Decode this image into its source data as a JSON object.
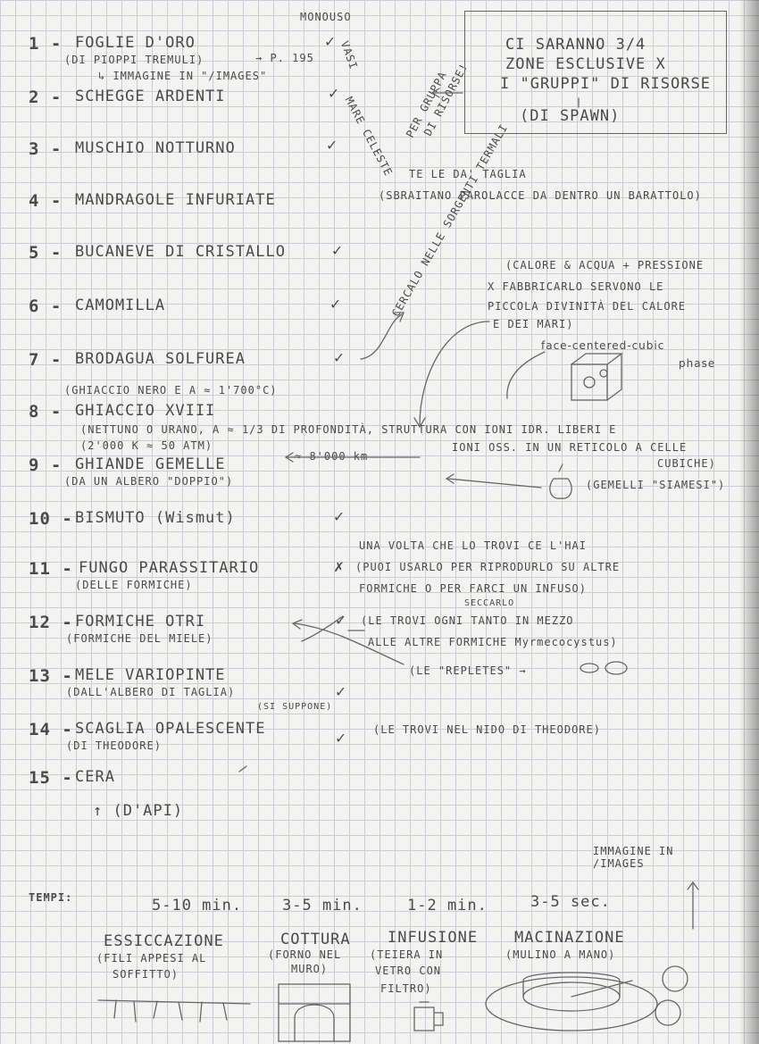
{
  "header": {
    "monouso": "MONOUSO"
  },
  "items": [
    {
      "number": "1 -",
      "name": "FOGLIE D'ORO",
      "sub": "(DI PIOPPI TREMULI)",
      "note": "→ P. 195",
      "note2": "↳ IMMAGINE IN \"/IMAGES\"",
      "check": "✓"
    },
    {
      "number": "2 -",
      "name": "SCHEGGE ARDENTI",
      "check": "✓"
    },
    {
      "number": "3 -",
      "name": "MUSCHIO NOTTURNO",
      "check": "✓"
    },
    {
      "number": "4 -",
      "name": "MANDRAGOLE INFURIATE"
    },
    {
      "number": "5 -",
      "name": "BUCANEVE DI CRISTALLO",
      "check": "✓"
    },
    {
      "number": "6 -",
      "name": "CAMOMILLA",
      "check": "✓"
    },
    {
      "number": "7 -",
      "name": "BRODAGUA SOLFUREA",
      "check": "✓"
    },
    {
      "number": "8 -",
      "name": "GHIACCIO XVIII",
      "pre": "(GHIACCIO NERO E A ≈ 1'700°C)",
      "sub": "(NETTUNO O URANO, A ≈ 1/3 DI PROFONDITÀ, STRUTTURA CON IONI IDR. LIBERI E",
      "sub2": "(2'000 K ≈ 50 ATM)",
      "sub3": "IONI OSS. IN UN RETICOLO A CELLE",
      "sub4": "CUBICHE)",
      "depth": "≈ 8'000 km"
    },
    {
      "number": "9 -",
      "name": "GHIANDE GEMELLE",
      "sub": "(DA UN ALBERO \"DOPPIO\")"
    },
    {
      "number": "10 -",
      "name": "BISMUTO (Wismut)",
      "check": "✓"
    },
    {
      "number": "11 -",
      "name": "FUNGO PARASSITARIO",
      "sub": "(DELLE FORMICHE)",
      "check": "✗"
    },
    {
      "number": "12 -",
      "name": "FORMICHE OTRI",
      "sub": "(FORMICHE DEL MIELE)",
      "check": "✓"
    },
    {
      "number": "13 -",
      "name": "MELE VARIOPINTE",
      "sub": "(DALL'ALBERO DI TAGLIA)",
      "check": "✓"
    },
    {
      "number": "14 -",
      "name": "SCAGLIA OPALESCENTE",
      "sub": "(DI THEODORE)",
      "check": "✓"
    },
    {
      "number": "15 -",
      "name": "CERA",
      "sub": "↑ (D'API)"
    }
  ],
  "box": {
    "line1": "CI SARANNO 3/4",
    "line2": "ZONE ESCLUSIVE X",
    "line3": "I \"GRUPPI\" DI RISORSE",
    "line4": "(DI SPAWN)"
  },
  "side_notes": {
    "per_gruppo": "PER GRUPPA",
    "di_risorse": "DI RISORSE!",
    "vasi": "VASI",
    "mare_celeste": "MARE CELESTE",
    "taglia": "TE LE DA' TAGLIA",
    "mandragole": "(SBRAITANO PAROLACCE DA DENTRO UN BARATTOLO)",
    "cercalo": "CERCALO NELLE SORGENTI TERMALI",
    "calore1": "(CALORE & ACQUA + PRESSIONE",
    "calore2": "X FABBRICARLO SERVONO LE",
    "calore3": "PICCOLA DIVINITÀ DEL CALORE",
    "calore4": "E DEI MARI)",
    "fcc1": "face-centered-cubic",
    "fcc2": "phase",
    "siamesi": "(GEMELLI \"SIAMESI\")",
    "fungo1": "UNA VOLTA CHE LO TROVI CE L'HAI",
    "fungo2": "(PUOI USARLO PER RIPRODURLO SU ALTRE",
    "fungo3": "FORMICHE O PER FARCI UN INFUSO)",
    "seccarlo": "SECCARLO",
    "otri1": "(LE TROVI OGNI TANTO IN MEZZO",
    "otri2": "ALLE ALTRE FORMICHE Myrmecocystus)",
    "repletes": "(LE \"REPLETES\" →",
    "suppone": "(SI SUPPONE)",
    "scaglia": "(LE TROVI NEL NIDO DI THEODORE)",
    "immagine": "IMMAGINE IN /IMAGES"
  },
  "tempi": {
    "label": "TEMPI:",
    "t1": "5-10 min.",
    "t2": "3-5 min.",
    "t3": "1-2 min.",
    "t4": "3-5 sec."
  },
  "processes": [
    {
      "name": "ESSICCAZIONE",
      "sub1": "(FILI APPESI AL",
      "sub2": "SOFFITTO)"
    },
    {
      "name": "COTTURA",
      "sub1": "(FORNO NEL",
      "sub2": "MURO)"
    },
    {
      "name": "INFUSIONE",
      "sub1": "(TEIERA IN",
      "sub2": "VETRO CON",
      "sub3": "FILTRO)"
    },
    {
      "name": "MACINAZIONE",
      "sub1": "(MULINO A MANO)"
    }
  ]
}
